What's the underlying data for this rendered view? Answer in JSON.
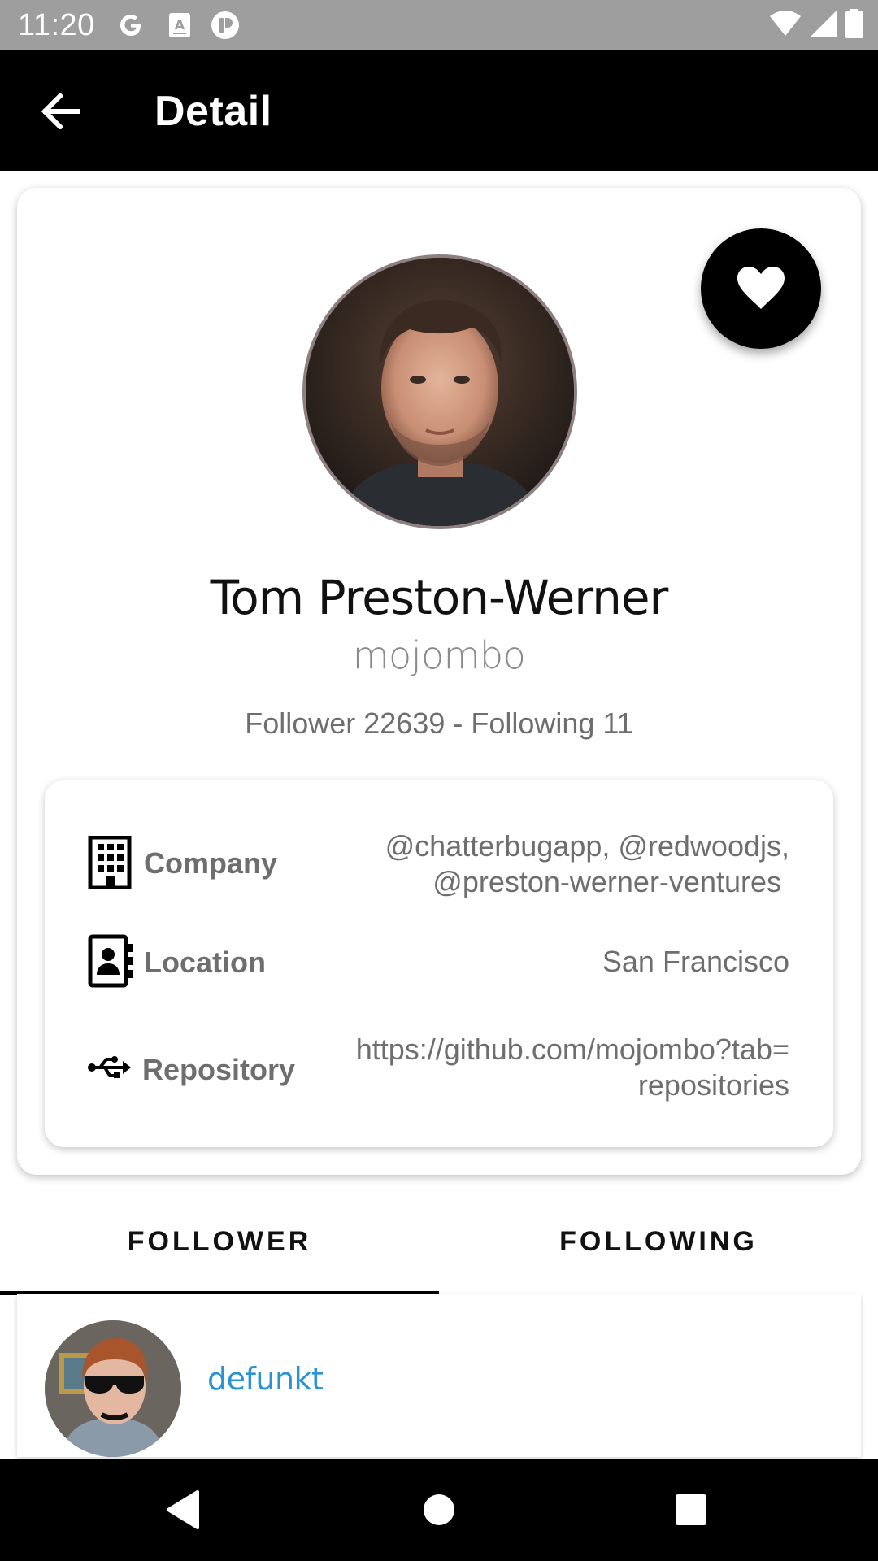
{
  "status_bar": {
    "time": "11:20",
    "left_icons": [
      "google-icon",
      "accessibility-icon",
      "app-icon"
    ],
    "right_icons": [
      "wifi-icon",
      "signal-icon",
      "battery-icon"
    ]
  },
  "app_bar": {
    "title": "Detail",
    "back_icon": "arrow-back-icon"
  },
  "profile": {
    "name": "Tom Preston-Werner",
    "username": "mojombo",
    "stats": "Follower 22639 - Following 11",
    "favorite_icon": "heart-icon"
  },
  "info": {
    "company": {
      "label": "Company",
      "value_line1": "@chatterbugapp, @redwoodjs,",
      "value_line2": "@preston-werner-ventures"
    },
    "location": {
      "label": "Location",
      "value": "San Francisco"
    },
    "repository": {
      "label": "Repository",
      "value_line1": "https://github.com/mojombo?tab=",
      "value_line2": "repositories"
    }
  },
  "tabs": [
    {
      "label": "FOLLOWER",
      "selected": true
    },
    {
      "label": "FOLLOWING",
      "selected": false
    }
  ],
  "followers": [
    {
      "login": "defunkt"
    }
  ],
  "colors": {
    "status_bar": "#9e9e9e",
    "app_bar": "#000000",
    "link": "#2a93d6",
    "secondary_text": "#6e6e6e"
  }
}
